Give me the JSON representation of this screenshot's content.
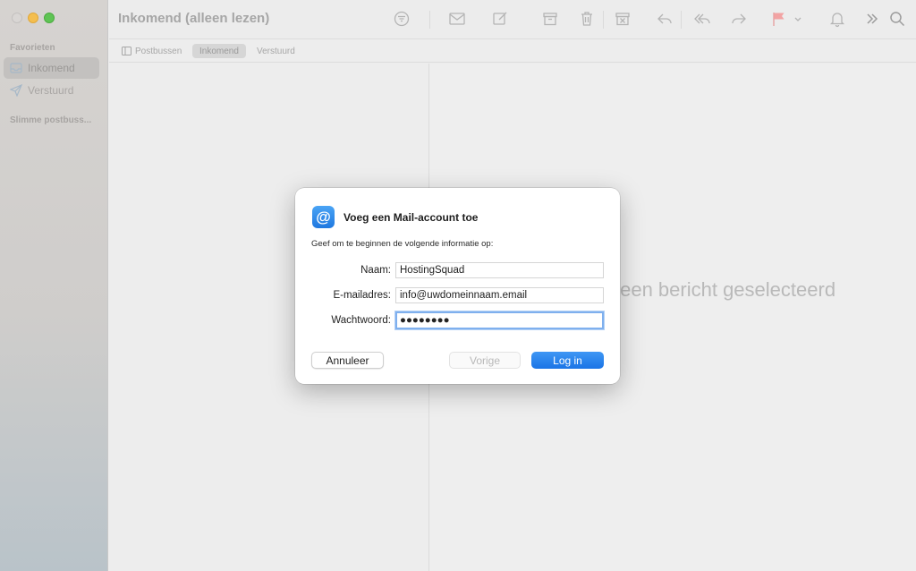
{
  "sidebar": {
    "favorites_header": "Favorieten",
    "items": [
      {
        "label": "Inkomend",
        "icon": "tray-icon",
        "active": true
      },
      {
        "label": "Verstuurd",
        "icon": "paper-plane-icon",
        "active": false
      }
    ],
    "smart_header": "Slimme postbuss..."
  },
  "toolbar": {
    "title": "Inkomend (alleen lezen)"
  },
  "tabs": [
    {
      "label": "Postbussen"
    },
    {
      "label": "Inkomend"
    },
    {
      "label": "Verstuurd"
    }
  ],
  "message_pane": {
    "empty_text": "Geen bericht geselecteerd"
  },
  "dialog": {
    "icon_glyph": "@",
    "title": "Voeg een Mail-account toe",
    "subtitle": "Geef om te beginnen de volgende informatie op:",
    "fields": {
      "name_label": "Naam:",
      "name_value": "HostingSquad",
      "email_label": "E-mailadres:",
      "email_value": "info@uwdomeinnaam.email",
      "password_label": "Wachtwoord:",
      "password_value": "●●●●●●●●"
    },
    "buttons": {
      "cancel": "Annuleer",
      "previous": "Vorige",
      "login": "Log in"
    }
  },
  "colors": {
    "accent": "#1a74e6",
    "flag": "#f2a3a3"
  }
}
